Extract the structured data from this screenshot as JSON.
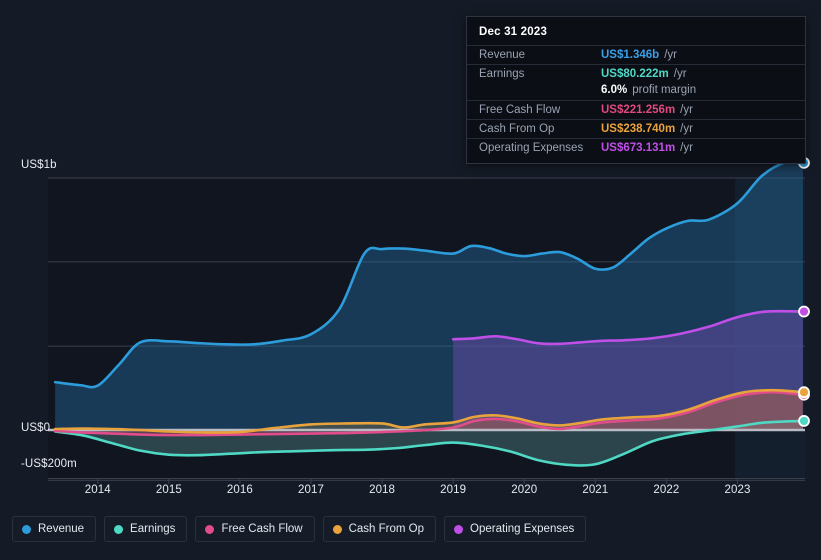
{
  "chart_data": {
    "type": "area",
    "title": "",
    "xlabel": "",
    "ylabel": "",
    "grid": true,
    "legend_position": "bottom",
    "xlim": [
      2013.3,
      2023.95
    ],
    "ylim": [
      -200,
      1000
    ],
    "y_unit": "US$ millions",
    "x_tick_labels": [
      "2014",
      "2015",
      "2016",
      "2017",
      "2018",
      "2019",
      "2020",
      "2021",
      "2022",
      "2023"
    ],
    "x_ticks": [
      2014,
      2015,
      2016,
      2017,
      2018,
      2019,
      2020,
      2021,
      2022,
      2023
    ],
    "y_tick_labels": [
      "US$1b",
      "US$0",
      "-US$200m"
    ],
    "y_ticks": [
      1000,
      0,
      -200
    ],
    "gridlines": [
      1000,
      667,
      333,
      0,
      -200
    ],
    "forecast_band_start": 2023.0,
    "series": [
      {
        "name": "Revenue",
        "color": "#2d9cdb",
        "fill": "rgba(35,110,165,0.42)",
        "x": [
          2013.4,
          2013.75,
          2014.0,
          2014.3,
          2014.6,
          2015.0,
          2015.4,
          2015.8,
          2016.2,
          2016.6,
          2017.0,
          2017.4,
          2017.75,
          2018.0,
          2018.3,
          2018.6,
          2019.0,
          2019.25,
          2019.5,
          2019.75,
          2020.0,
          2020.25,
          2020.5,
          2020.75,
          2021.0,
          2021.25,
          2021.5,
          2021.75,
          2022.0,
          2022.3,
          2022.6,
          2023.0,
          2023.35,
          2023.7,
          2023.92
        ],
        "y": [
          190,
          178,
          176,
          260,
          348,
          352,
          345,
          340,
          340,
          355,
          380,
          480,
          700,
          718,
          720,
          712,
          700,
          730,
          722,
          700,
          690,
          700,
          706,
          680,
          640,
          645,
          700,
          760,
          800,
          830,
          835,
          900,
          1010,
          1065,
          1060
        ],
        "end_value": 1346,
        "end_label": "US$1.346b /yr"
      },
      {
        "name": "Earnings",
        "color": "#4fd8c4",
        "fill": "rgba(120,190,190,0.28)",
        "x": [
          2013.4,
          2013.8,
          2014.2,
          2014.6,
          2015.0,
          2015.4,
          2015.8,
          2016.3,
          2016.8,
          2017.3,
          2017.8,
          2018.2,
          2018.6,
          2019.0,
          2019.4,
          2019.8,
          2020.2,
          2020.6,
          2021.0,
          2021.4,
          2021.8,
          2022.2,
          2022.6,
          2023.0,
          2023.4,
          2023.92
        ],
        "y": [
          -6,
          -22,
          -52,
          -82,
          -98,
          -100,
          -95,
          -88,
          -84,
          -80,
          -78,
          -72,
          -60,
          -50,
          -62,
          -85,
          -120,
          -138,
          -136,
          -95,
          -45,
          -18,
          -2,
          14,
          30,
          36
        ],
        "end_value": 80.222,
        "end_label": "US$80.222m /yr"
      },
      {
        "name": "Free Cash Flow",
        "color": "#e04d8a",
        "fill": "rgba(160,60,90,0.40)",
        "x": [
          2013.4,
          2013.8,
          2014.2,
          2014.6,
          2015.0,
          2015.5,
          2016.0,
          2016.5,
          2017.0,
          2017.5,
          2018.0,
          2018.5,
          2019.0,
          2019.3,
          2019.6,
          2019.9,
          2020.2,
          2020.5,
          2020.8,
          2021.1,
          2021.5,
          2021.9,
          2022.3,
          2022.7,
          2023.1,
          2023.5,
          2023.92
        ],
        "y": [
          -4,
          -10,
          -14,
          -18,
          -20,
          -20,
          -18,
          -16,
          -14,
          -12,
          -8,
          -2,
          10,
          36,
          44,
          34,
          14,
          4,
          16,
          30,
          38,
          46,
          70,
          110,
          140,
          150,
          140
        ],
        "end_value": 221.256,
        "end_label": "US$221.256m /yr"
      },
      {
        "name": "Cash From Op",
        "color": "#e8a33d",
        "fill": "rgba(190,140,60,0.25)",
        "x": [
          2013.4,
          2013.8,
          2014.2,
          2014.6,
          2015.0,
          2015.5,
          2016.0,
          2016.5,
          2017.0,
          2017.5,
          2018.0,
          2018.3,
          2018.6,
          2019.0,
          2019.3,
          2019.6,
          2019.9,
          2020.2,
          2020.5,
          2020.8,
          2021.1,
          2021.5,
          2021.9,
          2022.3,
          2022.7,
          2023.1,
          2023.5,
          2023.92
        ],
        "y": [
          4,
          6,
          4,
          0,
          -6,
          -10,
          -8,
          8,
          22,
          26,
          26,
          10,
          22,
          30,
          52,
          58,
          46,
          26,
          18,
          28,
          42,
          50,
          56,
          80,
          120,
          150,
          158,
          150
        ],
        "end_value": 238.74,
        "end_label": "US$238.740m /yr"
      },
      {
        "name": "Operating Expenses",
        "color": "#c04fe8",
        "fill": "rgba(98,74,160,0.55)",
        "x": [
          2019.0,
          2019.3,
          2019.6,
          2019.9,
          2020.2,
          2020.5,
          2020.8,
          2021.1,
          2021.4,
          2021.8,
          2022.2,
          2022.6,
          2023.0,
          2023.4,
          2023.92
        ],
        "y": [
          360,
          364,
          372,
          360,
          344,
          342,
          348,
          354,
          356,
          364,
          382,
          410,
          448,
          470,
          470
        ],
        "end_value": 673.131,
        "end_label": "US$673.131m /yr"
      }
    ]
  },
  "tooltip": {
    "date": "Dec 31 2023",
    "rows": [
      {
        "key": "Revenue",
        "value": "US$1.346b",
        "suffix": "/yr",
        "color": "#3aa0e8"
      },
      {
        "key": "Earnings",
        "value": "US$80.222m",
        "suffix": "/yr",
        "color": "#4fd8c4"
      },
      {
        "key": "",
        "value": "6.0%",
        "suffix": "profit margin",
        "color": "#ffffff",
        "margin_row": true
      },
      {
        "key": "Free Cash Flow",
        "value": "US$221.256m",
        "suffix": "/yr",
        "color": "#e0487f"
      },
      {
        "key": "Cash From Op",
        "value": "US$238.740m",
        "suffix": "/yr",
        "color": "#e8a33d"
      },
      {
        "key": "Operating Expenses",
        "value": "US$673.131m",
        "suffix": "/yr",
        "color": "#c04fe8"
      }
    ]
  },
  "legend": {
    "items": [
      {
        "label": "Revenue",
        "color": "#2d9cdb"
      },
      {
        "label": "Earnings",
        "color": "#4fd8c4"
      },
      {
        "label": "Free Cash Flow",
        "color": "#e04d8a"
      },
      {
        "label": "Cash From Op",
        "color": "#e8a33d"
      },
      {
        "label": "Operating Expenses",
        "color": "#c04fe8"
      }
    ]
  },
  "axes": {
    "y_labels": [
      {
        "text": "US$1b",
        "top": 159
      },
      {
        "text": "US$0",
        "top": 422
      },
      {
        "text": "-US$200m",
        "top": 458
      }
    ],
    "x_labels": [
      "2014",
      "2015",
      "2016",
      "2017",
      "2018",
      "2019",
      "2020",
      "2021",
      "2022",
      "2023"
    ]
  }
}
